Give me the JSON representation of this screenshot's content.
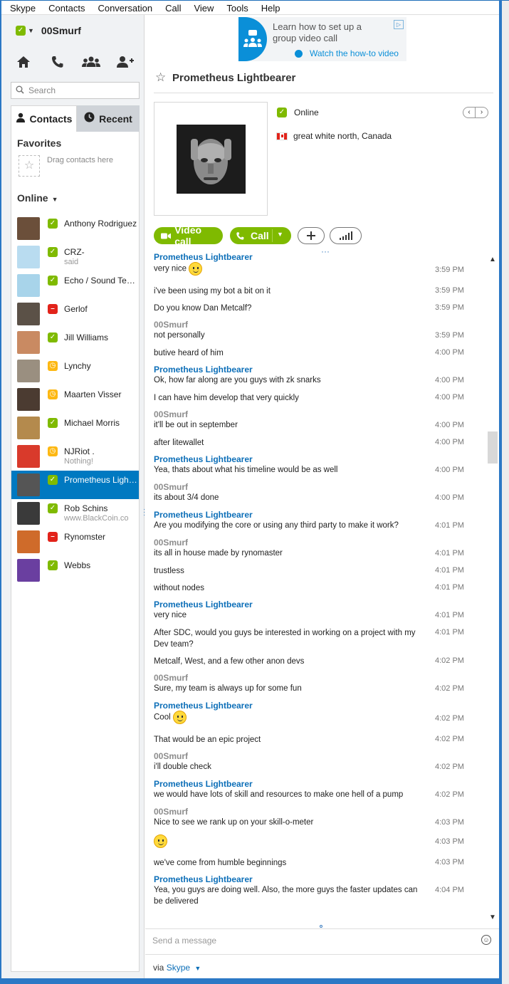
{
  "menu": [
    "Skype",
    "Contacts",
    "Conversation",
    "Call",
    "View",
    "Tools",
    "Help"
  ],
  "profile": {
    "name": "00Smurf",
    "status": "online"
  },
  "nav_icons": [
    "home-icon",
    "phone-icon",
    "group-icon",
    "add-contact-icon"
  ],
  "search": {
    "placeholder": "Search"
  },
  "tabs": {
    "contacts": "Contacts",
    "recent": "Recent"
  },
  "favorites": {
    "title": "Favorites",
    "hint": "Drag contacts here"
  },
  "online_section": {
    "title": "Online"
  },
  "contacts": [
    {
      "name": "Anthony Rodriguez",
      "mood": "",
      "status": "online"
    },
    {
      "name": "CRZ-",
      "mood": "said",
      "status": "online"
    },
    {
      "name": "Echo / Sound Test...",
      "mood": "",
      "status": "online"
    },
    {
      "name": "Gerlof",
      "mood": "",
      "status": "busy"
    },
    {
      "name": "Jill Williams",
      "mood": "",
      "status": "online"
    },
    {
      "name": "Lynchy",
      "mood": "",
      "status": "away"
    },
    {
      "name": "Maarten Visser",
      "mood": "",
      "status": "away"
    },
    {
      "name": "Michael Morris",
      "mood": "",
      "status": "online"
    },
    {
      "name": "NJRiot .",
      "mood": "Nothing!",
      "status": "away"
    },
    {
      "name": "Prometheus Lightb...",
      "mood": "",
      "status": "online",
      "selected": true
    },
    {
      "name": "Rob Schins",
      "mood": "www.BlackCoin.co",
      "status": "online"
    },
    {
      "name": "Rynomster",
      "mood": "",
      "status": "busy"
    },
    {
      "name": "Webbs",
      "mood": "",
      "status": "online"
    }
  ],
  "ad": {
    "text": "Learn how to set up a group video call",
    "link": "Watch the how-to video"
  },
  "conversation": {
    "title": "Prometheus Lightbearer",
    "presence": "Online",
    "location": "great white north, Canada",
    "video_call_label": "Video call",
    "call_label": "Call"
  },
  "messages": [
    {
      "sender": "Prometheus Lightbearer",
      "self": false,
      "text": "very nice",
      "emoji": true,
      "time": "3:59 PM"
    },
    {
      "sender": "",
      "text": "i've been using my bot a bit on it",
      "time": "3:59 PM"
    },
    {
      "sender": "",
      "text": "Do you know Dan Metcalf?",
      "time": "3:59 PM"
    },
    {
      "sender": "00Smurf",
      "self": true,
      "text": "not personally",
      "time": "3:59 PM"
    },
    {
      "sender": "",
      "text": "butive heard of him",
      "time": "4:00 PM"
    },
    {
      "sender": "Prometheus Lightbearer",
      "self": false,
      "text": "Ok, how far along are you guys with zk snarks",
      "time": "4:00 PM"
    },
    {
      "sender": "",
      "text": "I can have him develop that very quickly",
      "time": "4:00 PM"
    },
    {
      "sender": "00Smurf",
      "self": true,
      "text": "it'll be out in september",
      "time": "4:00 PM"
    },
    {
      "sender": "",
      "text": "after litewallet",
      "time": "4:00 PM"
    },
    {
      "sender": "Prometheus Lightbearer",
      "self": false,
      "text": "Yea, thats about what his timeline would be as well",
      "time": "4:00 PM"
    },
    {
      "sender": "00Smurf",
      "self": true,
      "text": "its about 3/4 done",
      "time": "4:00 PM"
    },
    {
      "sender": "Prometheus Lightbearer",
      "self": false,
      "text": "Are you modifying the core or using any third party to make it work?",
      "time": "4:01 PM"
    },
    {
      "sender": "00Smurf",
      "self": true,
      "text": "its all in house made by rynomaster",
      "time": "4:01 PM"
    },
    {
      "sender": "",
      "text": "trustless",
      "time": "4:01 PM"
    },
    {
      "sender": "",
      "text": "without nodes",
      "time": "4:01 PM"
    },
    {
      "sender": "Prometheus Lightbearer",
      "self": false,
      "text": "very nice",
      "time": "4:01 PM"
    },
    {
      "sender": "",
      "text": "After SDC, would you guys be interested in working on a project with my Dev team?",
      "time": "4:01 PM"
    },
    {
      "sender": "",
      "text": "Metcalf, West, and a few other anon devs",
      "time": "4:02 PM"
    },
    {
      "sender": "00Smurf",
      "self": true,
      "text": "Sure, my team is always up for some fun",
      "time": "4:02 PM"
    },
    {
      "sender": "Prometheus Lightbearer",
      "self": false,
      "text": "Cool",
      "emoji": true,
      "time": "4:02 PM"
    },
    {
      "sender": "",
      "text": "That would be an epic project",
      "time": "4:02 PM"
    },
    {
      "sender": "00Smurf",
      "self": true,
      "text": "i'll double check",
      "time": "4:02 PM"
    },
    {
      "sender": "Prometheus Lightbearer",
      "self": false,
      "text": "we would have lots of skill and resources to make one hell of a pump",
      "time": "4:02 PM"
    },
    {
      "sender": "00Smurf",
      "self": true,
      "text": "Nice to see we rank up on your skill-o-meter",
      "time": "4:03 PM"
    },
    {
      "sender": "",
      "text": "",
      "emoji": true,
      "time": "4:03 PM"
    },
    {
      "sender": "",
      "text": "we've come from humble beginnings",
      "time": "4:03 PM"
    },
    {
      "sender": "Prometheus Lightbearer",
      "self": false,
      "text": "Yea, you guys are doing well. Also, the more guys the faster updates can be delivered",
      "time": "4:04 PM"
    }
  ],
  "compose": {
    "placeholder": "Send a message"
  },
  "via": {
    "prefix": "via",
    "service": "Skype"
  },
  "colors": {
    "accent": "#0079c1",
    "online": "#7fba00",
    "busy": "#e2231a",
    "away": "#fdb813",
    "sender": "#0d6fb8"
  }
}
